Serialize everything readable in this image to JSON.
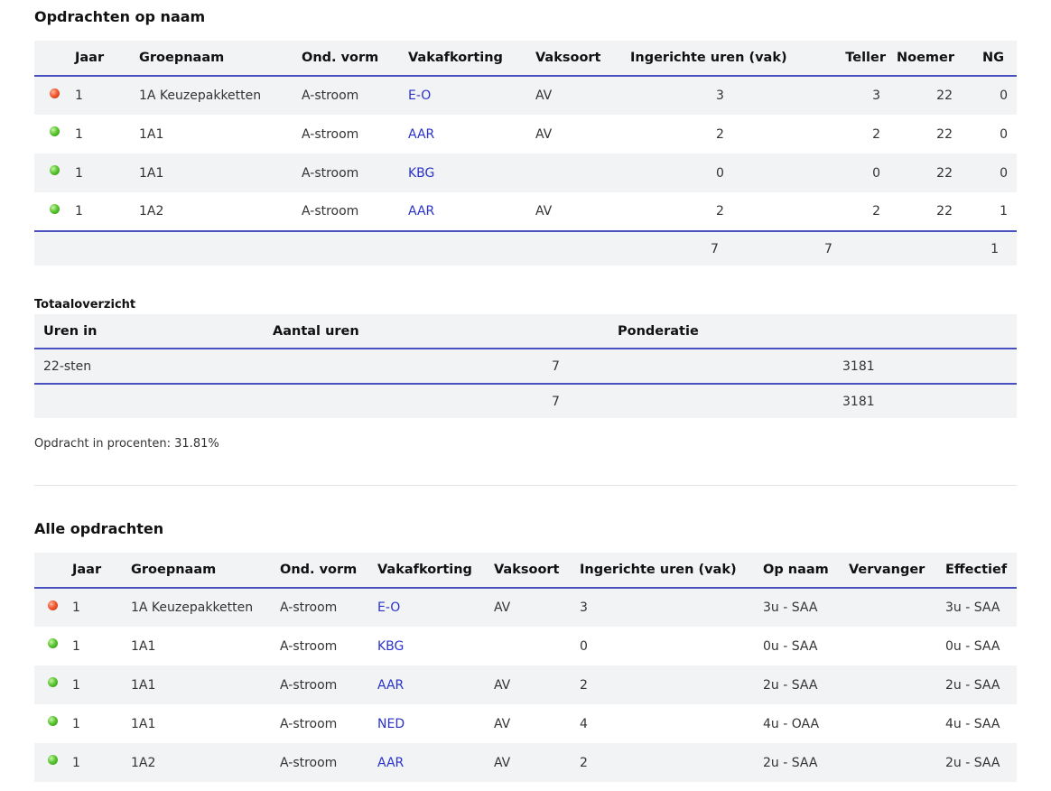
{
  "section1": {
    "title": "Opdrachten op naam",
    "columns": [
      "Jaar",
      "Groepnaam",
      "Ond. vorm",
      "Vakafkorting",
      "Vaksoort",
      "Ingerichte uren (vak)",
      "Teller",
      "Noemer",
      "NG"
    ],
    "rows": [
      {
        "status": "red",
        "jaar": "1",
        "groep": "1A Keuzepakketten",
        "vorm": "A-stroom",
        "vak": "E-O",
        "soort": "AV",
        "uren": "3",
        "teller": "3",
        "noemer": "22",
        "ng": "0"
      },
      {
        "status": "green",
        "jaar": "1",
        "groep": "1A1",
        "vorm": "A-stroom",
        "vak": "AAR",
        "soort": "AV",
        "uren": "2",
        "teller": "2",
        "noemer": "22",
        "ng": "0"
      },
      {
        "status": "green",
        "jaar": "1",
        "groep": "1A1",
        "vorm": "A-stroom",
        "vak": "KBG",
        "soort": "",
        "uren": "0",
        "teller": "0",
        "noemer": "22",
        "ng": "0"
      },
      {
        "status": "green",
        "jaar": "1",
        "groep": "1A2",
        "vorm": "A-stroom",
        "vak": "AAR",
        "soort": "AV",
        "uren": "2",
        "teller": "2",
        "noemer": "22",
        "ng": "1"
      }
    ],
    "totals": {
      "uren": "7",
      "teller": "7",
      "ng": "1"
    }
  },
  "section2": {
    "title": "Totaaloverzicht",
    "columns": [
      "Uren in",
      "Aantal uren",
      "Ponderatie"
    ],
    "rows": [
      {
        "uren_in": "22-sten",
        "aantal": "7",
        "ponderatie": "3181"
      }
    ],
    "totals": {
      "aantal": "7",
      "ponderatie": "3181"
    },
    "percent_text": "Opdracht in procenten: 31.81%"
  },
  "section3": {
    "title": "Alle opdrachten",
    "columns": [
      "Jaar",
      "Groepnaam",
      "Ond. vorm",
      "Vakafkorting",
      "Vaksoort",
      "Ingerichte uren (vak)",
      "Op naam",
      "Vervanger",
      "Effectief"
    ],
    "rows": [
      {
        "status": "red",
        "jaar": "1",
        "groep": "1A Keuzepakketten",
        "vorm": "A-stroom",
        "vak": "E-O",
        "soort": "AV",
        "uren": "3",
        "opnaam": "3u - SAA",
        "vervanger": "",
        "effectief": "3u - SAA"
      },
      {
        "status": "green",
        "jaar": "1",
        "groep": "1A1",
        "vorm": "A-stroom",
        "vak": "KBG",
        "soort": "",
        "uren": "0",
        "opnaam": "0u - SAA",
        "vervanger": "",
        "effectief": "0u - SAA"
      },
      {
        "status": "green",
        "jaar": "1",
        "groep": "1A1",
        "vorm": "A-stroom",
        "vak": "AAR",
        "soort": "AV",
        "uren": "2",
        "opnaam": "2u - SAA",
        "vervanger": "",
        "effectief": "2u - SAA"
      },
      {
        "status": "green",
        "jaar": "1",
        "groep": "1A1",
        "vorm": "A-stroom",
        "vak": "NED",
        "soort": "AV",
        "uren": "4",
        "opnaam": "4u - OAA",
        "vervanger": "",
        "effectief": "4u - SAA"
      },
      {
        "status": "green",
        "jaar": "1",
        "groep": "1A2",
        "vorm": "A-stroom",
        "vak": "AAR",
        "soort": "AV",
        "uren": "2",
        "opnaam": "2u - SAA",
        "vervanger": "",
        "effectief": "2u - SAA"
      }
    ]
  },
  "colors": {
    "accent": "#4a4fc0",
    "link": "#2a32c8",
    "row_alt": "#f2f3f5",
    "status_red": "#e84a20",
    "status_green": "#4cba28"
  }
}
